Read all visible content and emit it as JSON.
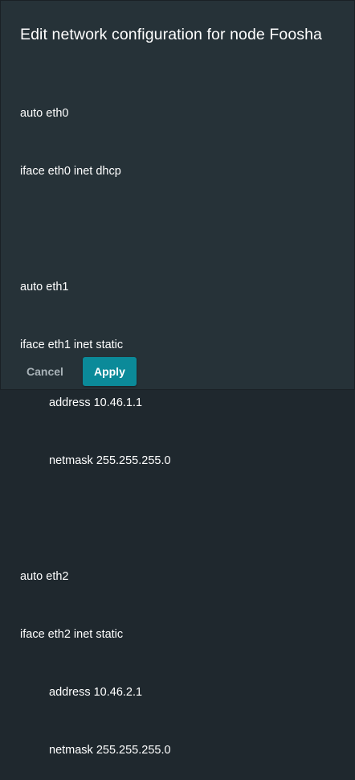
{
  "dialog": {
    "title": "Edit network configuration for node Foosha",
    "config_lines": [
      {
        "text": "auto eth0",
        "indent": false
      },
      {
        "text": "iface eth0 inet dhcp",
        "indent": false
      },
      {
        "text": "",
        "indent": false
      },
      {
        "text": "auto eth1",
        "indent": false
      },
      {
        "text": "iface eth1 inet static",
        "indent": false
      },
      {
        "text": "address 10.46.1.1",
        "indent": true
      },
      {
        "text": "netmask 255.255.255.0",
        "indent": true
      },
      {
        "text": "",
        "indent": false
      },
      {
        "text": "auto eth2",
        "indent": false
      },
      {
        "text": "iface eth2 inet static",
        "indent": false
      },
      {
        "text": "address 10.46.2.1",
        "indent": true
      },
      {
        "text": "netmask 255.255.255.0",
        "indent": true
      }
    ],
    "cancel_label": "Cancel",
    "apply_label": "Apply"
  },
  "colors": {
    "dialog_background": "#263238",
    "apply_button": "#0b8a99",
    "cancel_text": "#a9b3b8",
    "text": "#ffffff"
  }
}
